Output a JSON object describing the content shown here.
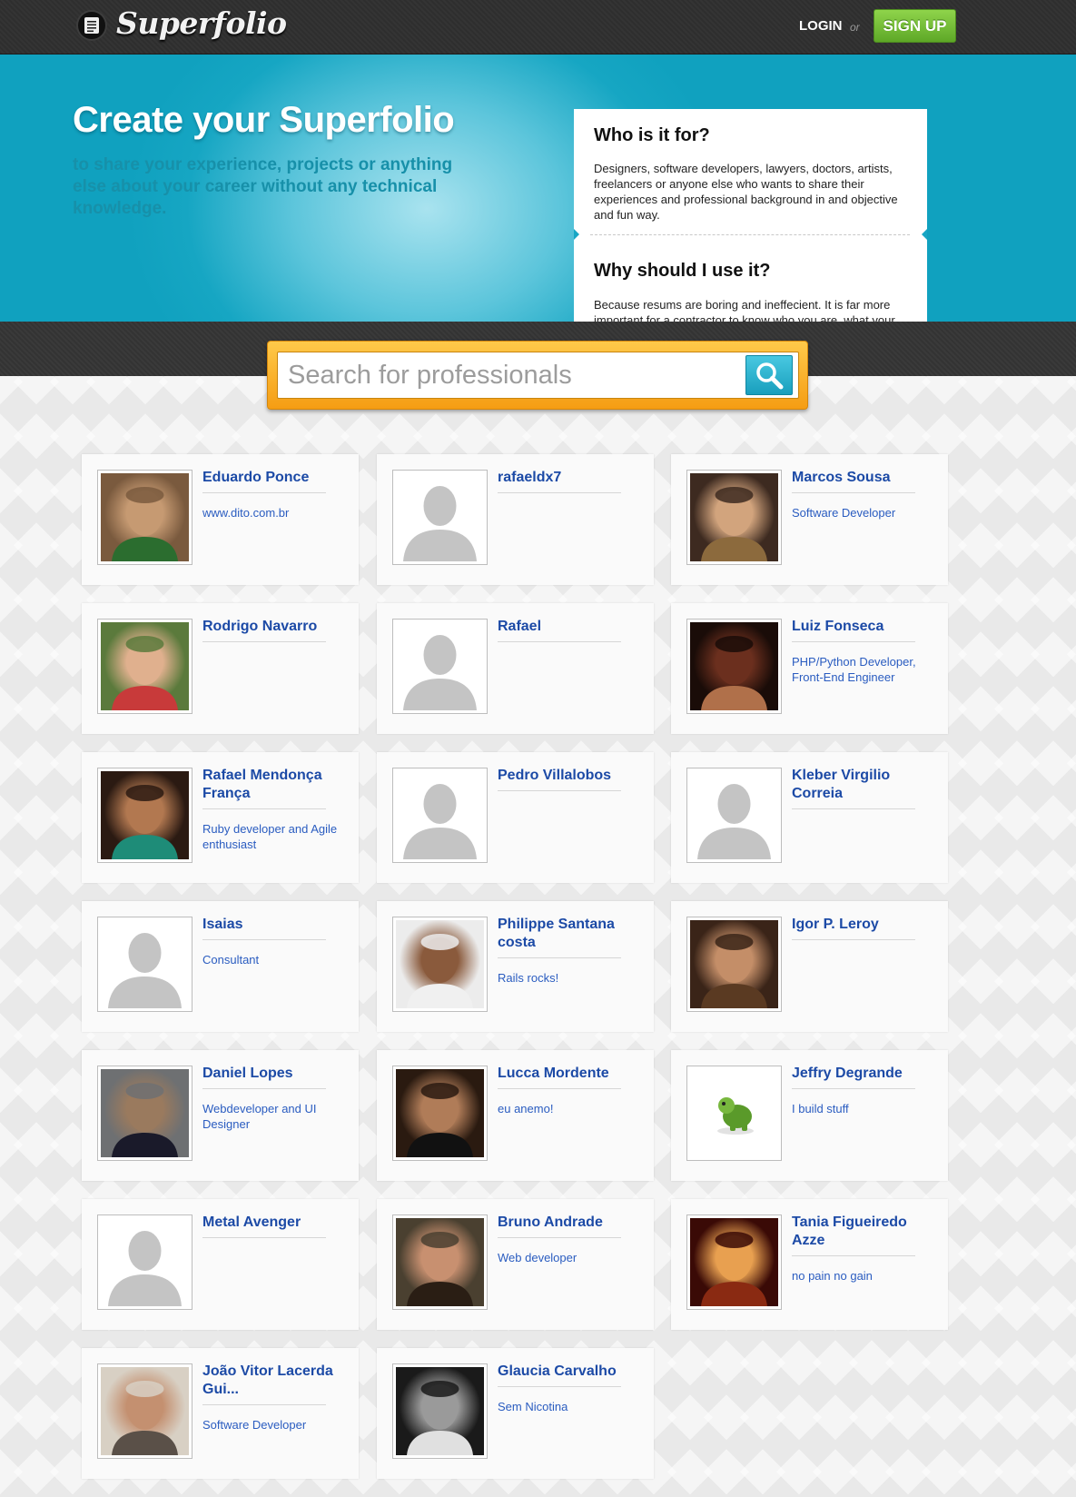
{
  "header": {
    "brand": "Superfolio",
    "login_label": "LOGIN",
    "or_label": "or",
    "signup_label": "SIGN UP"
  },
  "hero": {
    "title": "Create your Superfolio",
    "subtitle": "to share your experience, projects or anything else about your career without any technical knowledge."
  },
  "info": {
    "q1": "Who is it for?",
    "a1": "Designers, software developers, lawyers, doctors, artists, freelancers or anyone else who wants to share their experiences and professional background in and objective and fun way.",
    "q2": "Why should I use it?",
    "a2": "Because resums are boring and ineffecient. It is far more important for a contractor to know who you are, what your real experience is and what people say about you."
  },
  "search": {
    "placeholder": "Search for professionals"
  },
  "colors": {
    "link_blue": "#1c4aa6",
    "hero_teal": "#10a1bf",
    "signup_green": "#6db530",
    "search_orange": "#f5a41a"
  },
  "profiles": [
    {
      "name": "Eduardo Ponce",
      "role": "www.dito.com.br",
      "photo": "photo",
      "tone": [
        "#7a5a3e",
        "#c69a72",
        "#2b6d2f"
      ]
    },
    {
      "name": "rafaeldx7",
      "role": "",
      "photo": "placeholder"
    },
    {
      "name": "Marcos Sousa",
      "role": "Software Developer",
      "photo": "photo",
      "tone": [
        "#3d2a20",
        "#d2a47d",
        "#8c6a3d"
      ]
    },
    {
      "name": "Rodrigo Navarro",
      "role": "",
      "photo": "photo",
      "tone": [
        "#5b7a3c",
        "#e0b08e",
        "#c83a3a"
      ]
    },
    {
      "name": "Rafael",
      "role": "",
      "photo": "placeholder"
    },
    {
      "name": "Luiz Fonseca",
      "role": "PHP/Python Developer, Front-End Engineer",
      "photo": "photo",
      "tone": [
        "#1a0c08",
        "#6b2f1e",
        "#b0704a"
      ]
    },
    {
      "name": "Rafael Mendonça França",
      "role": "Ruby developer and Agile enthusiast",
      "photo": "photo",
      "tone": [
        "#2b1a12",
        "#b27850",
        "#1e8c78"
      ]
    },
    {
      "name": "Pedro Villalobos",
      "role": "",
      "photo": "placeholder"
    },
    {
      "name": "Kleber Virgilio Correia",
      "role": "",
      "photo": "placeholder"
    },
    {
      "name": "Isaias",
      "role": "Consultant",
      "photo": "placeholder"
    },
    {
      "name": "Philippe Santana costa",
      "role": "Rails rocks!",
      "photo": "photo",
      "tone": [
        "#ececec",
        "#8a5a3c",
        "#f0f0f0"
      ]
    },
    {
      "name": "Igor P. Leroy",
      "role": "",
      "photo": "photo",
      "tone": [
        "#3a2418",
        "#c48e68",
        "#5a3a22"
      ]
    },
    {
      "name": "Daniel Lopes",
      "role": "Webdeveloper and UI Designer",
      "photo": "photo",
      "tone": [
        "#6e7072",
        "#9a7a5e",
        "#1a1a2a"
      ]
    },
    {
      "name": "Lucca Mordente",
      "role": "eu anemo!",
      "photo": "photo",
      "tone": [
        "#2a1a10",
        "#b07c58",
        "#111111"
      ]
    },
    {
      "name": "Jeffry Degrande",
      "role": "I build stuff",
      "photo": "turtle"
    },
    {
      "name": "Metal Avenger",
      "role": "",
      "photo": "placeholder"
    },
    {
      "name": "Bruno Andrade",
      "role": "Web developer",
      "photo": "photo",
      "tone": [
        "#4a4030",
        "#c89070",
        "#2a1e14"
      ]
    },
    {
      "name": "Tania Figueiredo Azze",
      "role": "no pain no gain",
      "photo": "photo",
      "tone": [
        "#3a0a06",
        "#e8a050",
        "#8a2a12"
      ]
    },
    {
      "name": "João Vitor Lacerda Gui...",
      "role": "Software Developer",
      "photo": "photo",
      "tone": [
        "#d8d0c4",
        "#c49070",
        "#5a5048"
      ]
    },
    {
      "name": "Glaucia Carvalho",
      "role": "Sem Nicotina",
      "photo": "photo",
      "tone": [
        "#1a1a1a",
        "#9a9a9a",
        "#e0e0e0"
      ]
    }
  ]
}
